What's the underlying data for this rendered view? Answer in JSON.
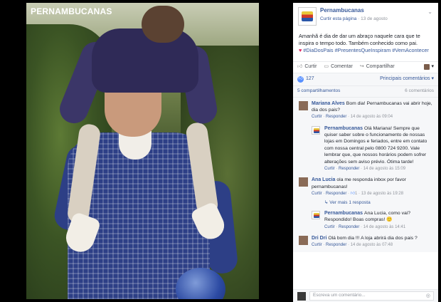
{
  "photo": {
    "brand_text": "PERNAMBUCANAS"
  },
  "post": {
    "page_name": "Pernambucanas",
    "like_page": "Curtir esta página",
    "date": "13 de agosto",
    "text_main": "Amanhã é dia de dar um abraço naquele cara que te inspira o tempo todo. Também conhecido como pai.",
    "hashtags": [
      "#DiaDosPais",
      "#PresentesQueInspiram",
      "#VemAcontecer"
    ],
    "actions": {
      "like": "Curtir",
      "comment": "Comentar",
      "share": "Compartilhar"
    },
    "likes": "127",
    "top_comments": "Principais comentários",
    "shares": "5 compartilhamentos",
    "comments_count": "6 comentários"
  },
  "comments": [
    {
      "author": "Mariana Alves",
      "text": "Bom dia! Pernambucanas vai abrir hoje, dia dos pais?",
      "like": "Curtir",
      "reply": "Responder",
      "time": "14 de agosto às 09:04",
      "is_reply": false
    },
    {
      "author": "Pernambucanas",
      "text": "Olá Mariana! Sempre que quiser saber sobre o funcionamento de nossas lojas em Domingos e feriados, entre em contato com nossa central pelo 0800 724 9200. Vale lembrar que, que nossos horários podem sofrer alterações sem aviso prévio. Ótima tarde!",
      "like": "Curtir",
      "reply": "Responder",
      "time": "14 de agosto às 15:09",
      "is_reply": true
    },
    {
      "author": "Ana Lucia",
      "text": "ola me responda inbox por favor pernambucanas!",
      "like": "Curtir",
      "reply": "Responder",
      "likes": "1",
      "time": "13 de agosto às 19:28",
      "is_reply": false
    },
    {
      "author": "Pernambucanas",
      "text": "Ana Lucia, como vai? Respondido! Boas compras! 🙂",
      "like": "Curtir",
      "reply": "Responder",
      "time": "14 de agosto às 14:41",
      "is_reply": true
    },
    {
      "author": "Dri Dri",
      "text": "Olá bom dia !!! A loja abrirá dia dos pais ?",
      "like": "Curtir",
      "reply": "Responder",
      "time": "14 de agosto às 07:48",
      "is_reply": false
    }
  ],
  "more_replies": "Ver mais 1 resposta",
  "write_placeholder": "Escreva um comentário..."
}
